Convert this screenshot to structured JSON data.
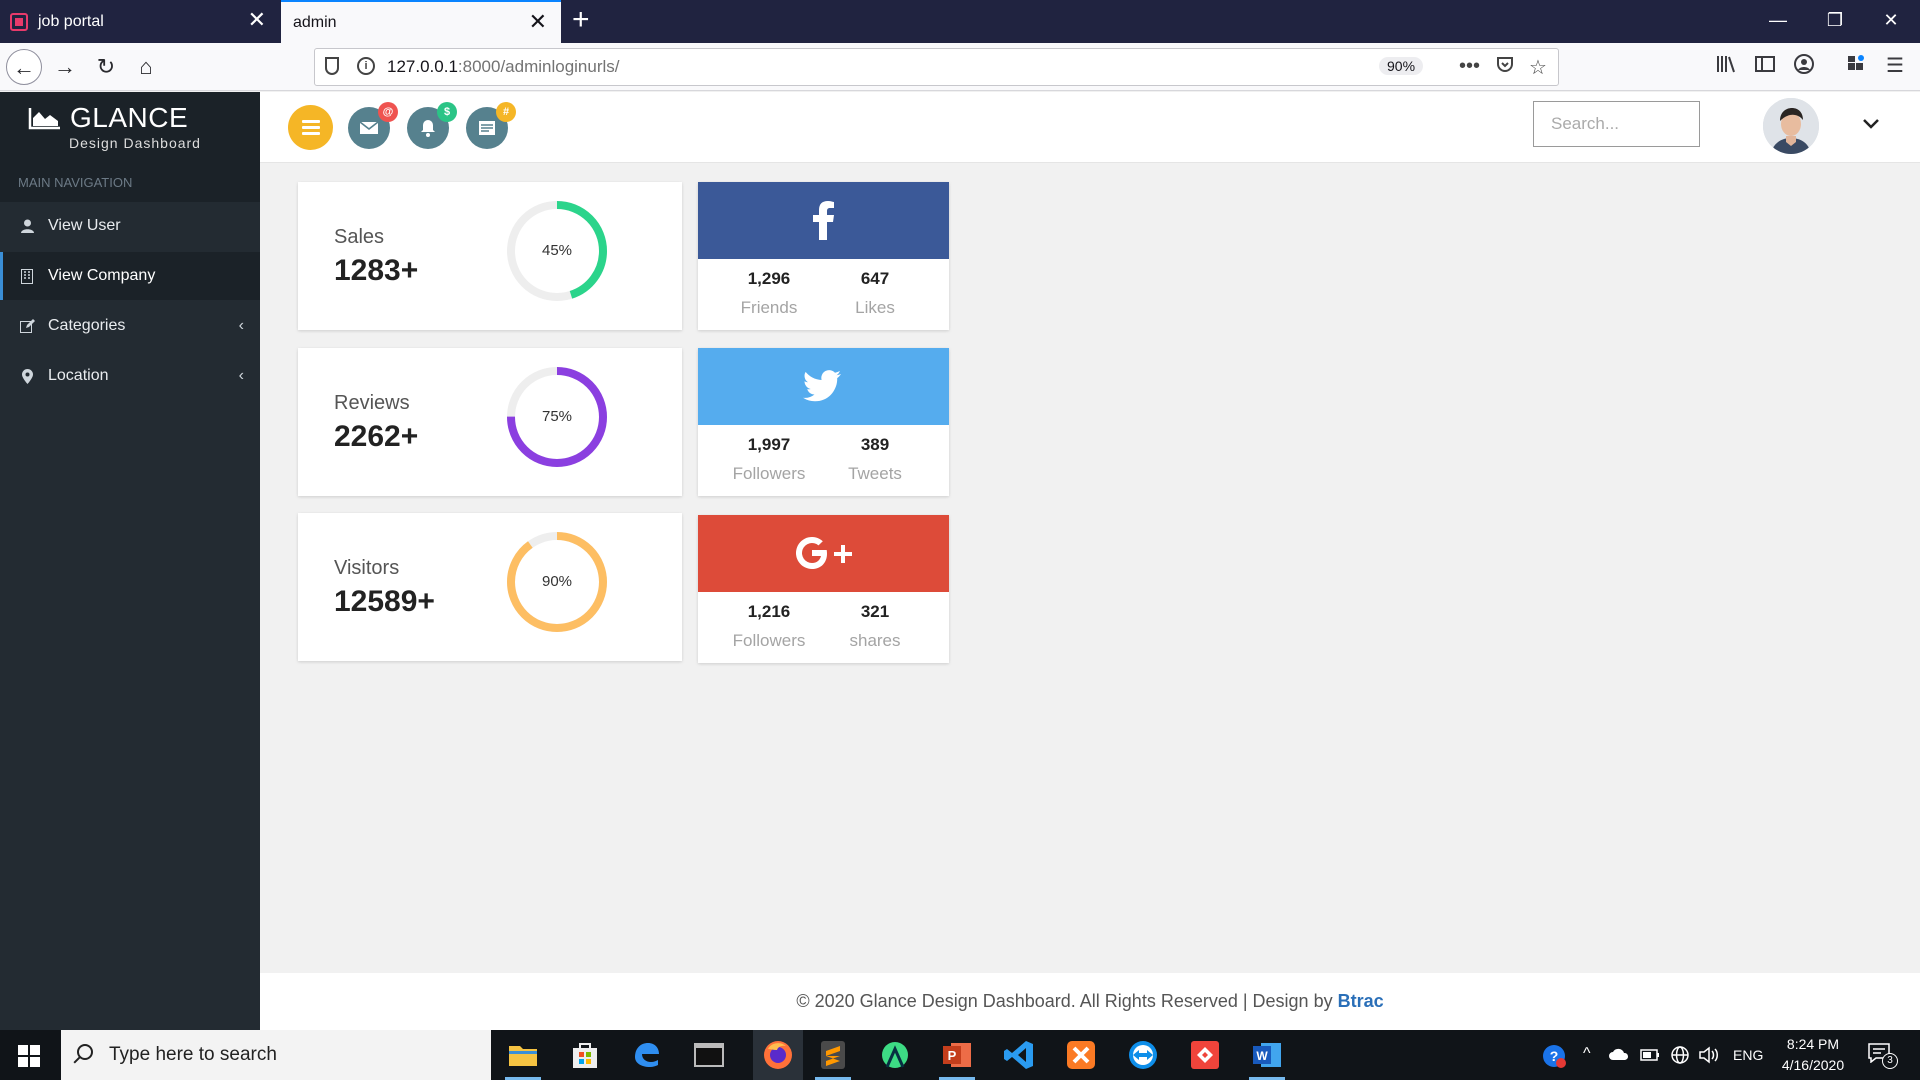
{
  "browser": {
    "tabs": [
      {
        "title": "job portal"
      },
      {
        "title": "admin"
      }
    ],
    "url_host": "127.0.0.1",
    "url_path": ":8000/adminloginurls/",
    "zoom": "90%"
  },
  "sidebar": {
    "brand_title": "GLANCE",
    "brand_subtitle": "Design Dashboard",
    "nav_heading": "MAIN NAVIGATION",
    "items": [
      {
        "label": "View User",
        "icon": "user-icon"
      },
      {
        "label": "View Company",
        "icon": "building-icon",
        "active": true
      },
      {
        "label": "Categories",
        "icon": "edit-icon",
        "expandable": true
      },
      {
        "label": "Location",
        "icon": "map-pin-icon",
        "expandable": true
      }
    ]
  },
  "header": {
    "badges": {
      "mail": "@",
      "bell": "$",
      "tasks": "#"
    },
    "search_placeholder": "Search..."
  },
  "stats": [
    {
      "label": "Sales",
      "value": "1283+",
      "percent": "45%",
      "fraction": 0.45,
      "color": "#2bd48b"
    },
    {
      "label": "Reviews",
      "value": "2262+",
      "percent": "75%",
      "fraction": 0.75,
      "color": "#8b3fe0"
    },
    {
      "label": "Visitors",
      "value": "12589+",
      "percent": "90%",
      "fraction": 0.9,
      "color": "#fdbe63"
    }
  ],
  "social": [
    {
      "network": "facebook",
      "color": "#3b5998",
      "stats": [
        {
          "num": "1,296",
          "label": "Friends"
        },
        {
          "num": "647",
          "label": "Likes"
        }
      ]
    },
    {
      "network": "twitter",
      "color": "#55acee",
      "stats": [
        {
          "num": "1,997",
          "label": "Followers"
        },
        {
          "num": "389",
          "label": "Tweets"
        }
      ]
    },
    {
      "network": "google-plus",
      "color": "#dd4b39",
      "stats": [
        {
          "num": "1,216",
          "label": "Followers"
        },
        {
          "num": "321",
          "label": "shares"
        }
      ]
    }
  ],
  "footer": {
    "text": "© 2020 Glance Design Dashboard. All Rights Reserved | Design by ",
    "link": "Btrac"
  },
  "taskbar": {
    "search_placeholder": "Type here to search",
    "language": "ENG",
    "time": "8:24 PM",
    "date": "4/16/2020",
    "notifications": "3"
  }
}
